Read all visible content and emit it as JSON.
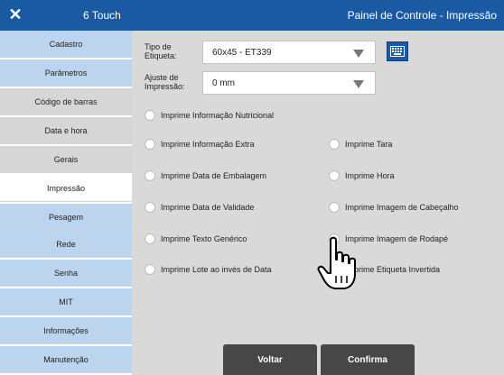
{
  "header": {
    "left_title": "6 Touch",
    "right_title": "Painel de Controle - Impressão",
    "close_icon": "close-icon",
    "bar_color": "#1a5aa3"
  },
  "sidebar": {
    "items": [
      {
        "label": "Cadastro"
      },
      {
        "label": "Parâmetros"
      },
      {
        "label": "Código de barras"
      },
      {
        "label": "Data e hora"
      },
      {
        "label": "Gerais"
      },
      {
        "label": "Impressão"
      },
      {
        "label": "Pesagem"
      },
      {
        "label": "Rede"
      },
      {
        "label": "Senha"
      },
      {
        "label": "MIT"
      },
      {
        "label": "Informações"
      },
      {
        "label": "Manutenção"
      }
    ],
    "selected": "Impressão"
  },
  "form": {
    "label_type": {
      "label": "Tipo de Etiqueta:",
      "value": "60x45 - ET339"
    },
    "print_adjust": {
      "label": "Ajuste de Impressão:",
      "value": "0 mm"
    },
    "keyboard_icon": "keyboard-icon"
  },
  "options": [
    {
      "label": "Imprime Informação Nutricional"
    },
    {
      "label": "Imprime Informação Extra"
    },
    {
      "label": "Imprime Tara"
    },
    {
      "label": "Imprime Data de Embalagem"
    },
    {
      "label": "Imprime Hora"
    },
    {
      "label": "Imprime Data de Validade"
    },
    {
      "label": "Imprime Imagem de Cabeçalho"
    },
    {
      "label": "Imprime Texto Genérico"
    },
    {
      "label": "Imprime Imagem de Rodapé"
    },
    {
      "label": "Imprime Lote ao invés de Data"
    },
    {
      "label": "Imprime Etiqueta Invertida"
    }
  ],
  "buttons": {
    "back": "Voltar",
    "confirm": "Confirma"
  },
  "cursor_icon": "hand-pointer-icon"
}
